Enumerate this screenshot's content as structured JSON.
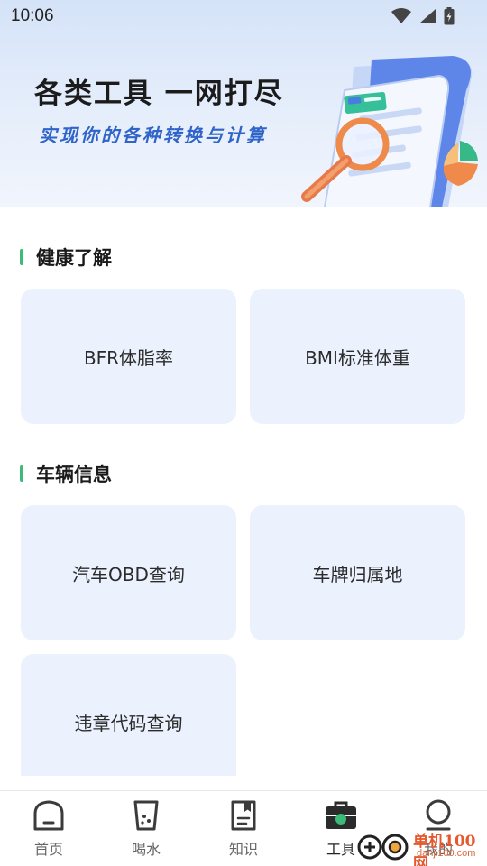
{
  "status_bar": {
    "time": "10:06",
    "icons": [
      "wifi-icon",
      "signal-icon",
      "battery-charging-icon"
    ]
  },
  "hero": {
    "title": "各类工具 一网打尽",
    "subtitle": "实现你的各种转换与计算",
    "illustration": "document-magnifier-illustration"
  },
  "sections": {
    "health": {
      "title": "健康了解",
      "items": [
        {
          "label": "BFR体脂率"
        },
        {
          "label": "BMI标准体重"
        }
      ]
    },
    "vehicle": {
      "title": "车辆信息",
      "items": [
        {
          "label": "汽车OBD查询"
        },
        {
          "label": "车牌归属地"
        },
        {
          "label": "违章代码查询"
        }
      ]
    }
  },
  "tab_bar": {
    "items": [
      {
        "label": "首页",
        "icon": "home-icon"
      },
      {
        "label": "喝水",
        "icon": "water-cup-icon"
      },
      {
        "label": "知识",
        "icon": "book-icon"
      },
      {
        "label": "工具",
        "icon": "toolbox-icon",
        "active": true
      },
      {
        "label": "我的",
        "icon": "profile-icon"
      }
    ]
  },
  "watermark": {
    "text": "单机100网",
    "url_text": "danji100.com"
  },
  "colors": {
    "accent_green": "#3cba78",
    "card_bg": "#ebf2fd",
    "subtitle_blue": "#2f64c9",
    "watermark_orange": "#e6582e"
  }
}
